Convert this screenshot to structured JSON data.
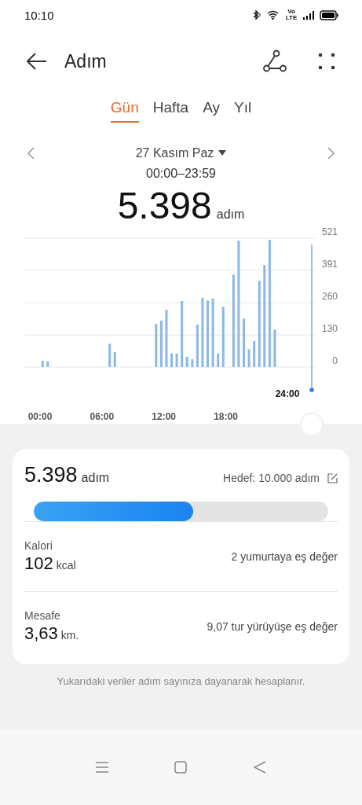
{
  "status_bar": {
    "time": "10:10",
    "network_label": "Vo LTE"
  },
  "header": {
    "title": "Adım"
  },
  "tabs": [
    {
      "label": "Gün",
      "selected": true
    },
    {
      "label": "Hafta",
      "selected": false
    },
    {
      "label": "Ay",
      "selected": false
    },
    {
      "label": "Yıl",
      "selected": false
    }
  ],
  "date_nav": {
    "date": "27 Kasım Paz",
    "time_range": "00:00–23:59",
    "total": "5.398",
    "unit": "adım"
  },
  "chart_data": {
    "type": "bar",
    "grid": true,
    "x": [
      0.25,
      0.75,
      6.75,
      7.25,
      11.25,
      11.75,
      12.25,
      12.75,
      13.25,
      13.75,
      14.25,
      14.75,
      15.25,
      15.75,
      16.25,
      16.75,
      17.25,
      17.75,
      18.75,
      19.25,
      19.75,
      20.25,
      20.75,
      21.25,
      21.75,
      22.25,
      22.75
    ],
    "values": [
      26,
      23,
      95,
      61,
      175,
      188,
      232,
      56,
      55,
      267,
      42,
      32,
      172,
      280,
      269,
      277,
      55,
      244,
      374,
      511,
      196,
      72,
      105,
      349,
      413,
      514,
      152
    ],
    "ylim": [
      0,
      521
    ],
    "yticks": [
      0,
      130,
      260,
      391,
      521
    ],
    "xlim": [
      -1.5,
      26.7
    ],
    "xticks": [
      {
        "value": 0,
        "label": "00:00"
      },
      {
        "value": 6,
        "label": "06:00"
      },
      {
        "value": 12,
        "label": "12:00"
      },
      {
        "value": 18,
        "label": "18:00"
      }
    ]
  },
  "chart_cursor": {
    "label": "24:00"
  },
  "summary": {
    "total": "5.398",
    "unit": "adım",
    "goal": "Hedef: 10.000 adım",
    "level": 0.54
  },
  "metrics": [
    {
      "label": "Kalori",
      "value": "102",
      "unit": "kcal",
      "equivalent": "2 yumurtaya eş değer"
    },
    {
      "label": "Mesafe",
      "value": "3,63",
      "unit": "km.",
      "equivalent": "9,07 tur yürüyüşe eş değer"
    }
  ],
  "footnote": "Yukarıdaki veriler adım sayınıza dayanarak hesaplanır."
}
